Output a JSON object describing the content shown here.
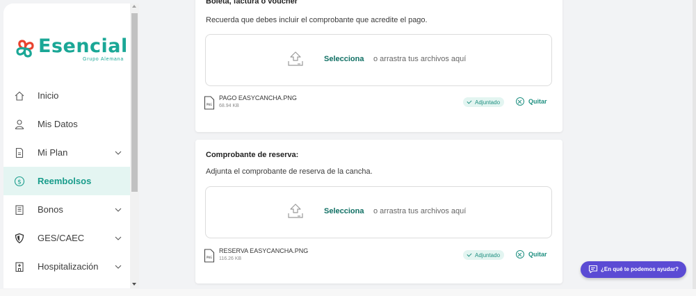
{
  "brand": {
    "name": "Esencial",
    "subtitle": "Grupo Alemana",
    "accent": "#1aa796"
  },
  "sidebar": {
    "items": [
      {
        "label": "Inicio",
        "icon": "home-icon",
        "expandable": false,
        "active": false
      },
      {
        "label": "Mis Datos",
        "icon": "user-icon",
        "expandable": false,
        "active": false
      },
      {
        "label": "Mi Plan",
        "icon": "document-icon",
        "expandable": true,
        "active": false
      },
      {
        "label": "Reembolsos",
        "icon": "dollar-circle-icon",
        "expandable": false,
        "active": true
      },
      {
        "label": "Bonos",
        "icon": "list-document-icon",
        "expandable": true,
        "active": false
      },
      {
        "label": "GES/CAEC",
        "icon": "shield-icon",
        "expandable": true,
        "active": false
      },
      {
        "label": "Hospitalización",
        "icon": "hospital-icon",
        "expandable": true,
        "active": false
      }
    ]
  },
  "main": {
    "section1": {
      "title": "Boleta, factura o voucher",
      "description": "Recuerda que debes incluir el comprobante que acredite el pago.",
      "dropzone": {
        "select_label": "Selecciona",
        "rest_label": "o arrastra tus archivos aquí"
      },
      "file": {
        "name": "PAGO EASYCANCHA.PNG",
        "size": "68.94 KB",
        "status": "Adjuntado",
        "remove_label": "Quitar"
      }
    },
    "section2": {
      "title": "Comprobante de reserva:",
      "description": "Adjunta el comprobante de reserva de la cancha.",
      "dropzone": {
        "select_label": "Selecciona",
        "rest_label": "o arrastra tus archivos aquí"
      },
      "file": {
        "name": "RESERVA EASYCANCHA.PNG",
        "size": "116.26 KB",
        "status": "Adjuntado",
        "remove_label": "Quitar"
      }
    }
  },
  "help": {
    "label": "¿En qué te podemos ayudar?",
    "color": "#5b4bd4"
  }
}
